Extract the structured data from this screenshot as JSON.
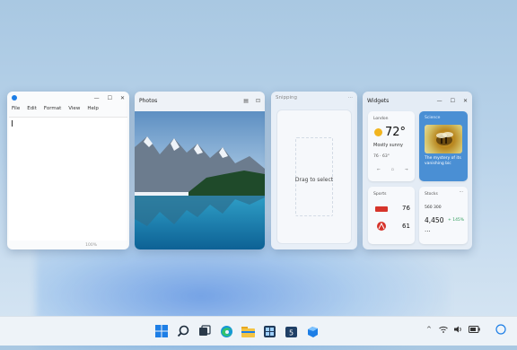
{
  "notepad": {
    "menu": [
      "File",
      "Edit",
      "Format",
      "View",
      "Help"
    ],
    "status": "100%"
  },
  "photos": {
    "title": "Photos"
  },
  "snipping": {
    "title": "Snipping",
    "prompt": "Drag to select"
  },
  "widgets": {
    "title": "Widgets",
    "weather": {
      "location": "London",
      "temp": "72°",
      "condition": "Mostly sunny",
      "range": "76 · 63°"
    },
    "news": {
      "source": "Science",
      "headline": "The mystery of its vanishing bic"
    },
    "sports": {
      "label": "Sports",
      "score1": "76",
      "score2": "61"
    },
    "stocks": {
      "label": "Stocks",
      "value1": "560 300",
      "value2": "4,450",
      "change": "+ 145%"
    }
  },
  "taskbar": {
    "icons": [
      "start-icon",
      "search-icon",
      "task-view-icon",
      "edge-icon",
      "file-explorer-icon",
      "widgets-app-icon",
      "store-icon",
      "windows-app-icon"
    ]
  },
  "colors": {
    "accent": "#1d7ee6",
    "positive": "#2e9c5a",
    "red": "#d6342b"
  }
}
